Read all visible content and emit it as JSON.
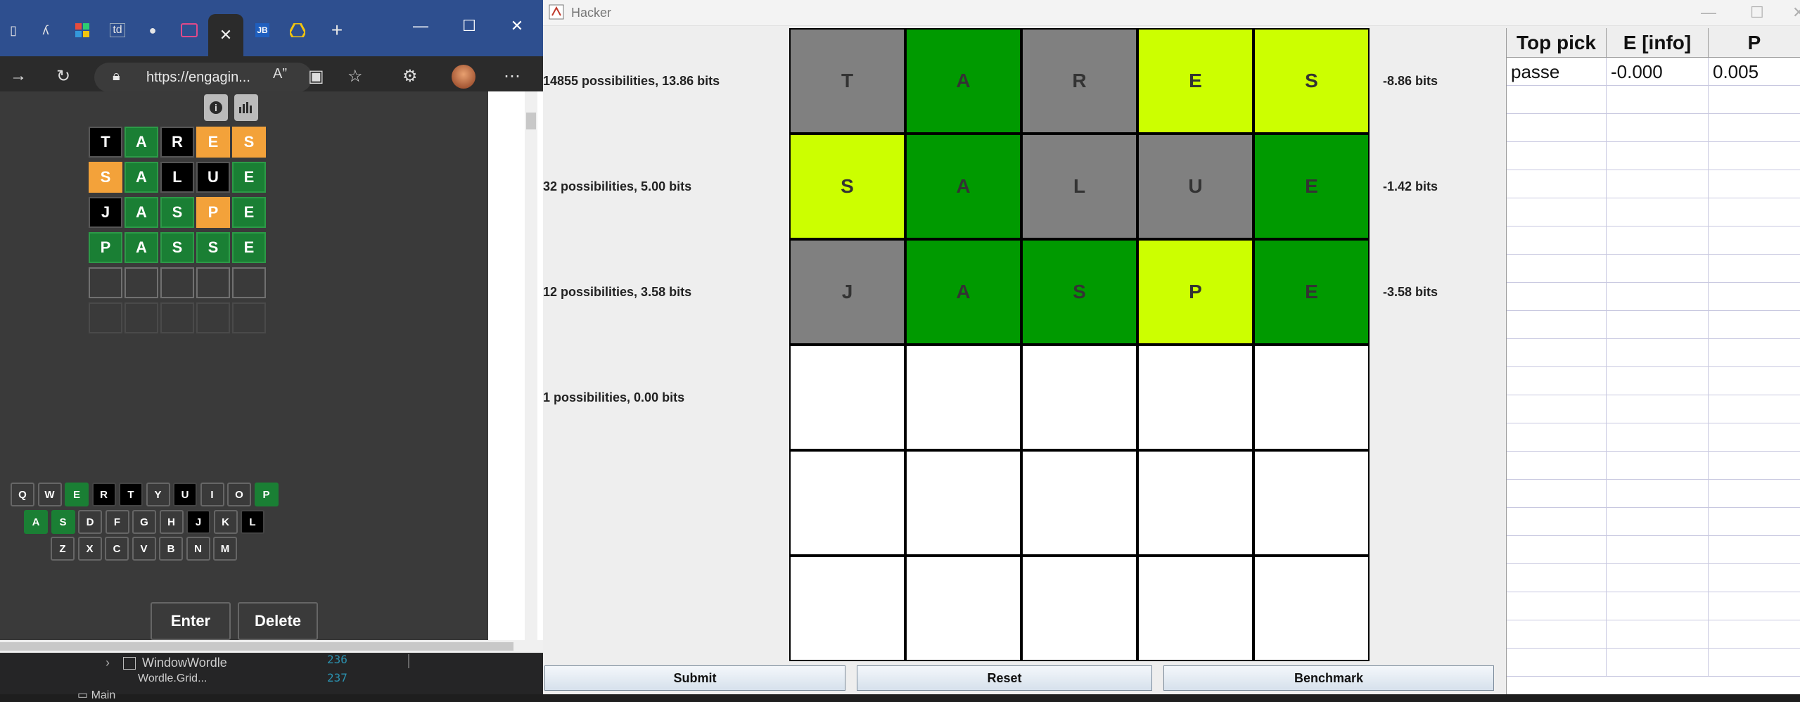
{
  "browser": {
    "url": "https://engagin...",
    "window_controls": [
      "minimize-icon",
      "maximize-icon",
      "close-icon"
    ],
    "tabs_icons": [
      "page-icon",
      "read-icon",
      "grid-icon",
      "td-icon",
      "github-icon",
      "wordle-icon",
      "close-tab-icon",
      "jb-icon",
      "drive-icon",
      "new-tab-icon"
    ],
    "tab_td_label": "td",
    "tab_jb_label": "JB"
  },
  "wordle": {
    "rows": [
      [
        {
          "l": "T",
          "s": "black"
        },
        {
          "l": "A",
          "s": "green"
        },
        {
          "l": "R",
          "s": "black"
        },
        {
          "l": "E",
          "s": "orange"
        },
        {
          "l": "S",
          "s": "orange"
        }
      ],
      [
        {
          "l": "S",
          "s": "orange"
        },
        {
          "l": "A",
          "s": "green"
        },
        {
          "l": "L",
          "s": "black"
        },
        {
          "l": "U",
          "s": "black"
        },
        {
          "l": "E",
          "s": "green"
        }
      ],
      [
        {
          "l": "J",
          "s": "black"
        },
        {
          "l": "A",
          "s": "green"
        },
        {
          "l": "S",
          "s": "green"
        },
        {
          "l": "P",
          "s": "orange"
        },
        {
          "l": "E",
          "s": "green"
        }
      ],
      [
        {
          "l": "P",
          "s": "green"
        },
        {
          "l": "A",
          "s": "green"
        },
        {
          "l": "S",
          "s": "green"
        },
        {
          "l": "S",
          "s": "green"
        },
        {
          "l": "E",
          "s": "green"
        }
      ],
      [
        {
          "l": "",
          "s": "empty"
        },
        {
          "l": "",
          "s": "empty"
        },
        {
          "l": "",
          "s": "empty"
        },
        {
          "l": "",
          "s": "empty"
        },
        {
          "l": "",
          "s": "empty"
        }
      ],
      [
        {
          "l": "",
          "s": "faint"
        },
        {
          "l": "",
          "s": "faint"
        },
        {
          "l": "",
          "s": "faint"
        },
        {
          "l": "",
          "s": "faint"
        },
        {
          "l": "",
          "s": "faint"
        }
      ]
    ],
    "keyboard": [
      [
        {
          "k": "Q",
          "s": ""
        },
        {
          "k": "W",
          "s": ""
        },
        {
          "k": "E",
          "s": "green"
        },
        {
          "k": "R",
          "s": "black"
        },
        {
          "k": "T",
          "s": "black"
        },
        {
          "k": "Y",
          "s": ""
        },
        {
          "k": "U",
          "s": "black"
        },
        {
          "k": "I",
          "s": ""
        },
        {
          "k": "O",
          "s": ""
        },
        {
          "k": "P",
          "s": "green"
        }
      ],
      [
        {
          "k": "A",
          "s": "green"
        },
        {
          "k": "S",
          "s": "green"
        },
        {
          "k": "D",
          "s": ""
        },
        {
          "k": "F",
          "s": ""
        },
        {
          "k": "G",
          "s": ""
        },
        {
          "k": "H",
          "s": ""
        },
        {
          "k": "J",
          "s": "black"
        },
        {
          "k": "K",
          "s": ""
        },
        {
          "k": "L",
          "s": "black"
        }
      ],
      [
        {
          "k": "Z",
          "s": ""
        },
        {
          "k": "X",
          "s": ""
        },
        {
          "k": "C",
          "s": ""
        },
        {
          "k": "V",
          "s": ""
        },
        {
          "k": "B",
          "s": ""
        },
        {
          "k": "N",
          "s": ""
        },
        {
          "k": "M",
          "s": ""
        }
      ]
    ],
    "enter_label": "Enter",
    "delete_label": "Delete"
  },
  "ide": {
    "tree_item": "WindowWordle",
    "tree_item_cut": "Wordle.Grid...",
    "line_numbers": [
      "236",
      "237"
    ],
    "bottom_label": "Main"
  },
  "hacker": {
    "title": "Hacker",
    "rows_info": [
      {
        "info": "14855 possibilities, 13.86 bits",
        "bits": "-8.86 bits"
      },
      {
        "info": "32 possibilities, 5.00 bits",
        "bits": "-1.42 bits"
      },
      {
        "info": "12 possibilities, 3.58 bits",
        "bits": "-3.58 bits"
      },
      {
        "info": "1 possibilities, 0.00 bits",
        "bits": ""
      }
    ],
    "grid": [
      [
        {
          "l": "T",
          "s": "gray"
        },
        {
          "l": "A",
          "s": "green"
        },
        {
          "l": "R",
          "s": "gray"
        },
        {
          "l": "E",
          "s": "yellow"
        },
        {
          "l": "S",
          "s": "yellow"
        }
      ],
      [
        {
          "l": "S",
          "s": "yellow"
        },
        {
          "l": "A",
          "s": "green"
        },
        {
          "l": "L",
          "s": "gray"
        },
        {
          "l": "U",
          "s": "gray"
        },
        {
          "l": "E",
          "s": "green"
        }
      ],
      [
        {
          "l": "J",
          "s": "gray"
        },
        {
          "l": "A",
          "s": "green"
        },
        {
          "l": "S",
          "s": "green"
        },
        {
          "l": "P",
          "s": "yellow"
        },
        {
          "l": "E",
          "s": "green"
        }
      ],
      [
        {
          "l": "",
          "s": ""
        },
        {
          "l": "",
          "s": ""
        },
        {
          "l": "",
          "s": ""
        },
        {
          "l": "",
          "s": ""
        },
        {
          "l": "",
          "s": ""
        }
      ],
      [
        {
          "l": "",
          "s": ""
        },
        {
          "l": "",
          "s": ""
        },
        {
          "l": "",
          "s": ""
        },
        {
          "l": "",
          "s": ""
        },
        {
          "l": "",
          "s": ""
        }
      ],
      [
        {
          "l": "",
          "s": ""
        },
        {
          "l": "",
          "s": ""
        },
        {
          "l": "",
          "s": ""
        },
        {
          "l": "",
          "s": ""
        },
        {
          "l": "",
          "s": ""
        }
      ]
    ],
    "buttons": {
      "submit": "Submit",
      "reset": "Reset",
      "benchmark": "Benchmark"
    },
    "table": {
      "headers": [
        "Top pick",
        "E [info]",
        "P"
      ],
      "rows": [
        [
          "passe",
          "-0.000",
          "0.005"
        ]
      ]
    }
  }
}
